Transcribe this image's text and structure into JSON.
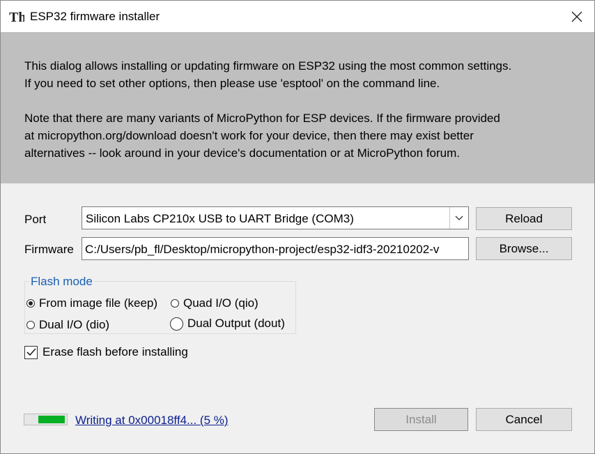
{
  "window": {
    "title": "ESP32 firmware installer"
  },
  "info": {
    "para1_line1": "This dialog allows installing or updating firmware on ESP32 using the most common settings.",
    "para1_line2": "If you need to set other options, then please use 'esptool' on the command line.",
    "para2_line1": "Note that there are many variants of MicroPython for ESP devices. If the firmware provided",
    "para2_line2": "at micropython.org/download doesn't work for your device, then there may exist better",
    "para2_line3": "alternatives -- look around in your device's documentation or at MicroPython forum."
  },
  "port": {
    "label": "Port",
    "value": "Silicon Labs CP210x USB to UART Bridge (COM3)",
    "reload_label": "Reload"
  },
  "firmware": {
    "label": "Firmware",
    "value": "C:/Users/pb_fl/Desktop/micropython-project/esp32-idf3-20210202-v",
    "browse_label": "Browse..."
  },
  "flash_mode": {
    "title": "Flash mode",
    "options": [
      {
        "label": "From image file (keep)",
        "selected": true
      },
      {
        "label": "Quad I/O (qio)",
        "selected": false
      },
      {
        "label": "Dual I/O (dio)",
        "selected": false
      },
      {
        "label": "Dual Output (dout)",
        "selected": false
      }
    ]
  },
  "erase": {
    "label": "Erase flash before installing",
    "checked": true
  },
  "status": {
    "text": "Writing at 0x00018ff4... (5 %)",
    "progress_fraction": 0.05
  },
  "buttons": {
    "install_label": "Install",
    "cancel_label": "Cancel"
  },
  "colors": {
    "progress": "#06b025",
    "link": "#0b1f8f",
    "info_bg": "#bfbfbf"
  }
}
